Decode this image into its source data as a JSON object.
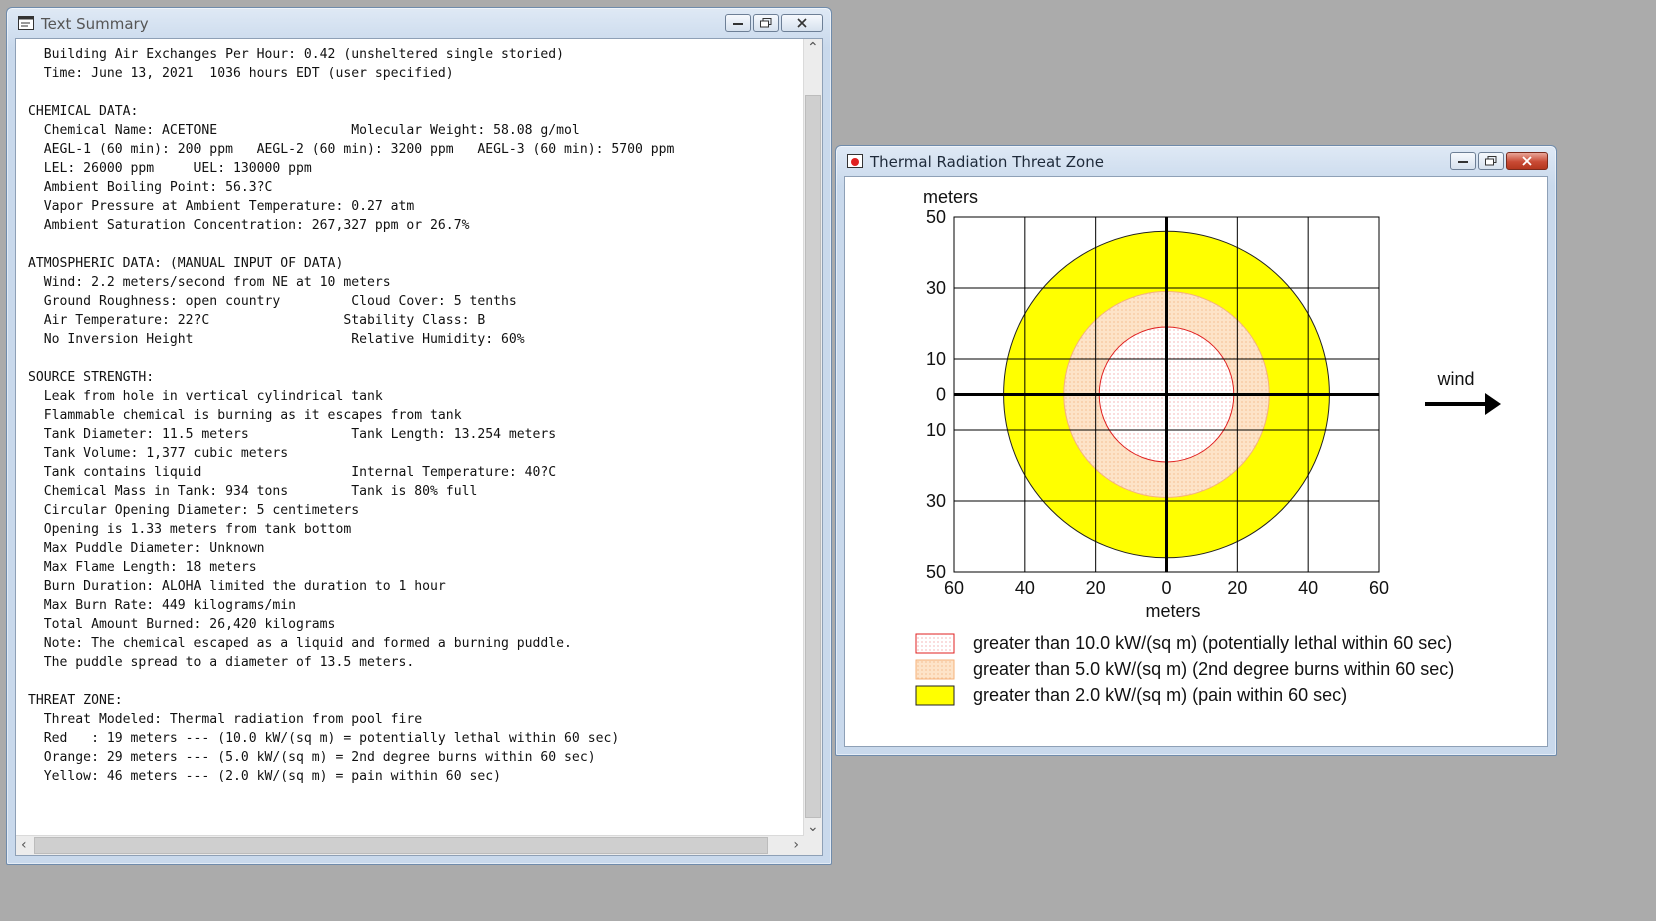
{
  "text_summary": {
    "title": "Text Summary",
    "lines": [
      "  Building Air Exchanges Per Hour: 0.42 (unsheltered single storied)",
      "  Time: June 13, 2021  1036 hours EDT (user specified)",
      "",
      "CHEMICAL DATA:",
      "  Chemical Name: ACETONE                 Molecular Weight: 58.08 g/mol",
      "  AEGL-1 (60 min): 200 ppm   AEGL-2 (60 min): 3200 ppm   AEGL-3 (60 min): 5700 ppm",
      "  LEL: 26000 ppm     UEL: 130000 ppm",
      "  Ambient Boiling Point: 56.3?C",
      "  Vapor Pressure at Ambient Temperature: 0.27 atm",
      "  Ambient Saturation Concentration: 267,327 ppm or 26.7%",
      "",
      "ATMOSPHERIC DATA: (MANUAL INPUT OF DATA)",
      "  Wind: 2.2 meters/second from NE at 10 meters",
      "  Ground Roughness: open country         Cloud Cover: 5 tenths",
      "  Air Temperature: 22?C                 Stability Class: B",
      "  No Inversion Height                    Relative Humidity: 60%",
      "",
      "SOURCE STRENGTH:",
      "  Leak from hole in vertical cylindrical tank",
      "  Flammable chemical is burning as it escapes from tank",
      "  Tank Diameter: 11.5 meters             Tank Length: 13.254 meters",
      "  Tank Volume: 1,377 cubic meters",
      "  Tank contains liquid                   Internal Temperature: 40?C",
      "  Chemical Mass in Tank: 934 tons        Tank is 80% full",
      "  Circular Opening Diameter: 5 centimeters",
      "  Opening is 1.33 meters from tank bottom",
      "  Max Puddle Diameter: Unknown",
      "  Max Flame Length: 18 meters",
      "  Burn Duration: ALOHA limited the duration to 1 hour",
      "  Max Burn Rate: 449 kilograms/min",
      "  Total Amount Burned: 26,420 kilograms",
      "  Note: The chemical escaped as a liquid and formed a burning puddle.",
      "  The puddle spread to a diameter of 13.5 meters.",
      "",
      "THREAT ZONE:",
      "  Threat Modeled: Thermal radiation from pool fire",
      "  Red   : 19 meters --- (10.0 kW/(sq m) = potentially lethal within 60 sec)",
      "  Orange: 29 meters --- (5.0 kW/(sq m) = 2nd degree burns within 60 sec)",
      "  Yellow: 46 meters --- (2.0 kW/(sq m) = pain within 60 sec)"
    ]
  },
  "thermal_window": {
    "title": "Thermal Radiation Threat Zone",
    "y_unit": "meters",
    "x_unit": "meters",
    "wind_label": "wind",
    "y_ticks": [
      "50",
      "30",
      "10",
      "0",
      "10",
      "30",
      "50"
    ],
    "x_ticks": [
      "60",
      "40",
      "20",
      "0",
      "20",
      "40",
      "60"
    ],
    "x_range": [
      -60,
      60
    ],
    "y_range": [
      -50,
      50
    ],
    "grid": "on, every 20 m in x; y lines at 50, 30, 10, -10, -30, -50",
    "zones": [
      {
        "name": "red",
        "radius_m": 19,
        "fill": "#fde6e6",
        "stroke": "#e02020",
        "legend": "greater than 10.0 kW/(sq m) (potentially lethal within 60 sec)"
      },
      {
        "name": "orange",
        "radius_m": 29,
        "fill": "#fde3c8",
        "stroke": "#f5b27a",
        "legend": "greater than 5.0 kW/(sq m) (2nd degree burns within 60 sec)"
      },
      {
        "name": "yellow",
        "radius_m": 46,
        "fill": "#ffff00",
        "stroke": "#222222",
        "legend": "greater than 2.0 kW/(sq m) (pain within 60 sec)"
      }
    ]
  }
}
